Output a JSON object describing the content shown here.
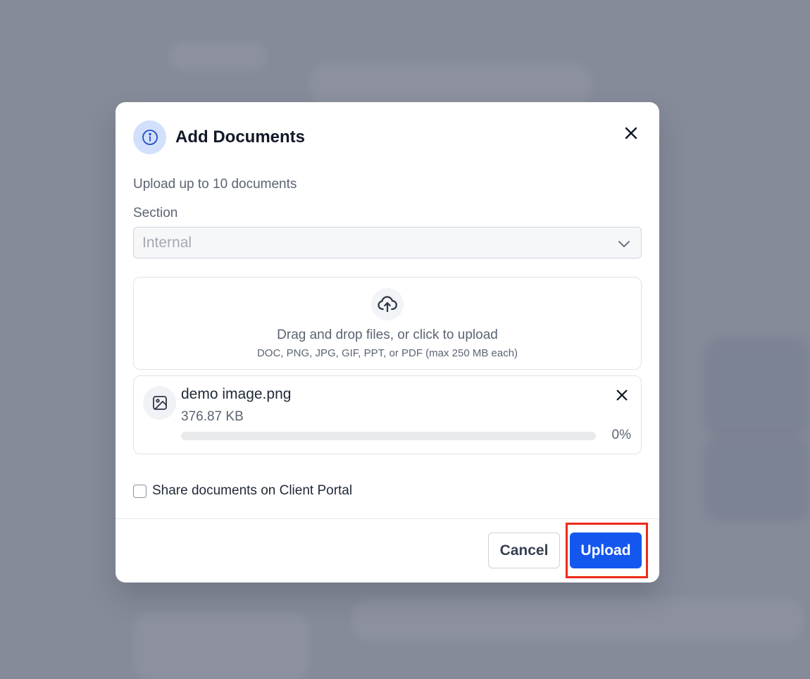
{
  "modal": {
    "title": "Add Documents",
    "subtitle": "Upload up to 10 documents",
    "section_label": "Section",
    "section_value": "Internal"
  },
  "dropzone": {
    "main_text": "Drag and drop files, or click to upload",
    "sub_text": "DOC, PNG, JPG, GIF, PPT, or PDF (max 250 MB each)"
  },
  "file": {
    "name": "demo image.png",
    "size": "376.87 KB",
    "progress_text": "0%",
    "progress_value": 0
  },
  "share": {
    "label": "Share documents on Client Portal",
    "checked": false
  },
  "footer": {
    "cancel_label": "Cancel",
    "upload_label": "Upload"
  },
  "icons": {
    "header": "info-icon",
    "close": "close-icon",
    "select": "chevron-down-icon",
    "dropzone": "cloud-upload-icon",
    "file": "image-icon",
    "file_remove": "close-icon"
  },
  "colors": {
    "primary": "#1457ee",
    "highlight": "#ec2b17",
    "overlay": "#868b9a"
  }
}
